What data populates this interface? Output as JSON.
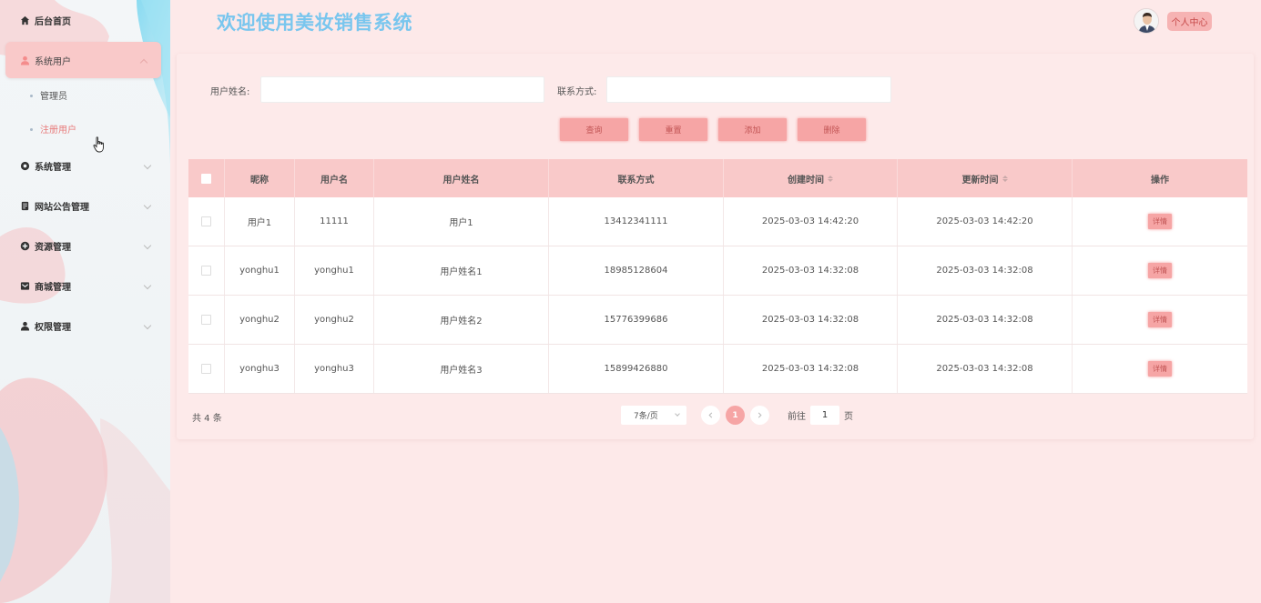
{
  "app": {
    "title": "欢迎使用美妆销售系统",
    "profile_label": "个人中心"
  },
  "sidebar": {
    "items": [
      {
        "label": "后台首页",
        "icon": "home-icon"
      },
      {
        "label": "系统用户",
        "icon": "user-icon",
        "expanded": true,
        "children": [
          {
            "label": "管理员"
          },
          {
            "label": "注册用户",
            "active": true
          }
        ]
      },
      {
        "label": "系统管理",
        "icon": "gear-icon"
      },
      {
        "label": "网站公告管理",
        "icon": "document-icon"
      },
      {
        "label": "资源管理",
        "icon": "plus-circle-icon"
      },
      {
        "label": "商城管理",
        "icon": "mail-icon"
      },
      {
        "label": "权限管理",
        "icon": "person-icon"
      }
    ]
  },
  "search": {
    "name_label": "用户姓名:",
    "name_value": "",
    "contact_label": "联系方式:",
    "contact_value": ""
  },
  "actions": {
    "query": "查询",
    "reset": "重置",
    "add": "添加",
    "delete": "删除"
  },
  "table": {
    "headers": [
      "昵称",
      "用户名",
      "用户姓名",
      "联系方式",
      "创建时间",
      "更新时间",
      "操作"
    ],
    "rows": [
      {
        "nickname": "用户1",
        "username": "11111",
        "realname": "用户1",
        "contact": "13412341111",
        "created": "2025-03-03 14:42:20",
        "updated": "2025-03-03 14:42:20",
        "action": "详情"
      },
      {
        "nickname": "yonghu1",
        "username": "yonghu1",
        "realname": "用户姓名1",
        "contact": "18985128604",
        "created": "2025-03-03 14:32:08",
        "updated": "2025-03-03 14:32:08",
        "action": "详情"
      },
      {
        "nickname": "yonghu2",
        "username": "yonghu2",
        "realname": "用户姓名2",
        "contact": "15776399686",
        "created": "2025-03-03 14:32:08",
        "updated": "2025-03-03 14:32:08",
        "action": "详情"
      },
      {
        "nickname": "yonghu3",
        "username": "yonghu3",
        "realname": "用户姓名3",
        "contact": "15899426880",
        "created": "2025-03-03 14:32:08",
        "updated": "2025-03-03 14:32:08",
        "action": "详情"
      }
    ]
  },
  "pagination": {
    "total": "共 4 条",
    "page_size": "7条/页",
    "current_page": "1",
    "goto_prefix": "前往",
    "goto_value": "1",
    "goto_suffix": "页"
  },
  "colors": {
    "accent": "#f6a5a5",
    "title": "#79c6ee",
    "header_row": "#f9c9c9",
    "background": "#fde9e9"
  }
}
